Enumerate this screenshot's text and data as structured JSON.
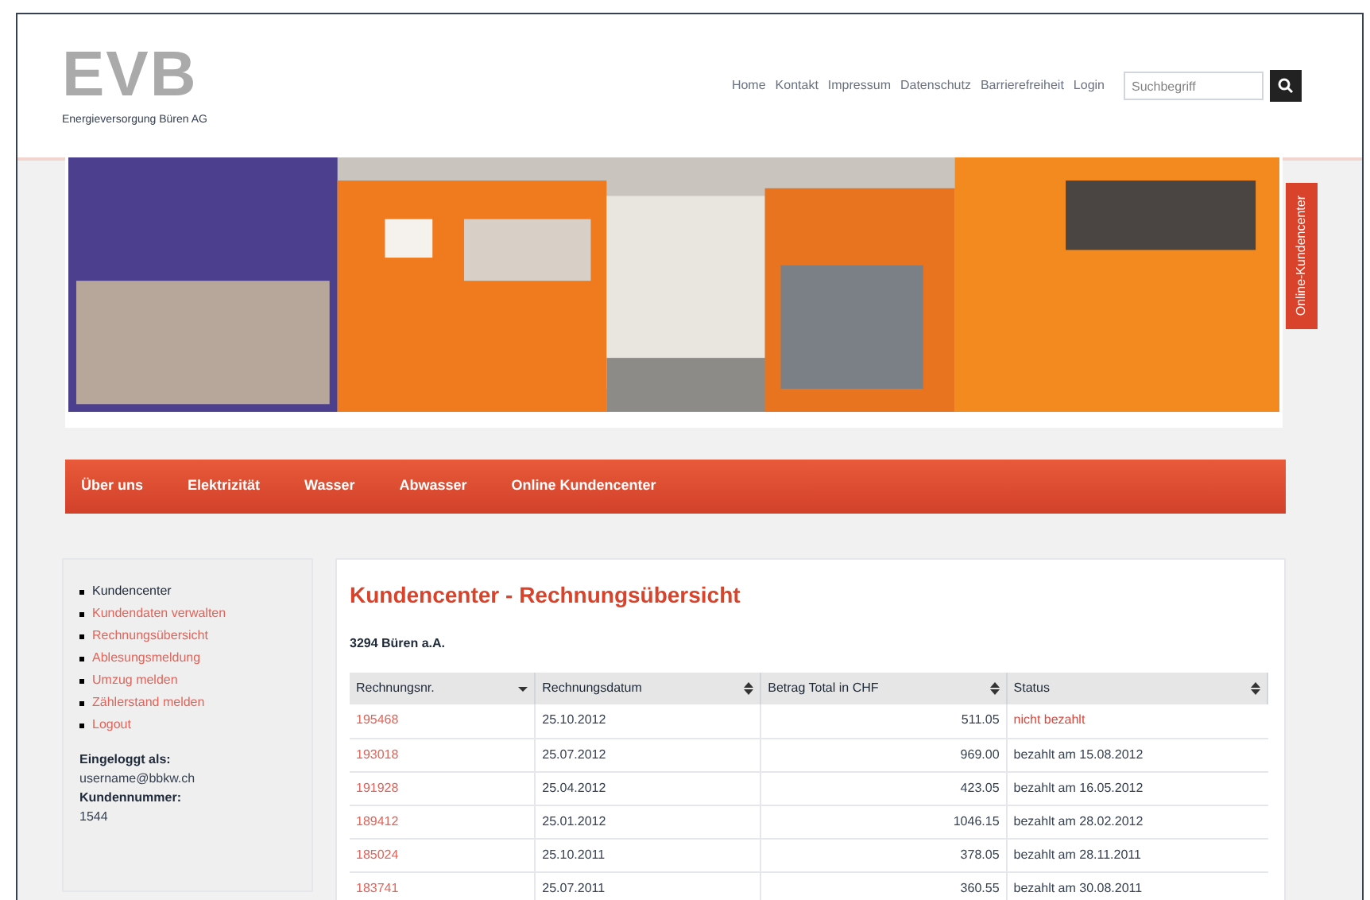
{
  "logo": {
    "letters": "EVB",
    "subtitle": "Energieversorgung Büren AG"
  },
  "top_nav": [
    "Home",
    "Kontakt",
    "Impressum",
    "Datenschutz",
    "Barrierefreiheit",
    "Login"
  ],
  "search": {
    "placeholder": "Suchbegriff"
  },
  "banner": {
    "kind": "picture"
  },
  "side_tab": "Online-Kundencenter",
  "menu": [
    "Über uns",
    "Elektrizität",
    "Wasser",
    "Abwasser",
    "Online Kundencenter"
  ],
  "sidebar": {
    "items": [
      {
        "label": "Kundencenter",
        "selected": true
      },
      {
        "label": "Kundendaten verwalten",
        "selected": false
      },
      {
        "label": "Rechnungsübersicht",
        "selected": false
      },
      {
        "label": "Ablesungsmeldung",
        "selected": false
      },
      {
        "label": "Umzug melden",
        "selected": false
      },
      {
        "label": "Zählerstand melden",
        "selected": false
      },
      {
        "label": "Logout",
        "selected": false
      }
    ],
    "login_label": "Eingeloggt als:",
    "login_value": "username@bbkw.ch",
    "customer_label": "Kundennummer:",
    "customer_value": "1544"
  },
  "main": {
    "title": "Kundencenter - Rechnungsübersicht",
    "location": "3294 Büren a.A.",
    "columns": [
      {
        "label": "Rechnungsnr.",
        "sorted": true
      },
      {
        "label": "Rechnungsdatum",
        "sorted": false
      },
      {
        "label": "Betrag Total in CHF",
        "sorted": false
      },
      {
        "label": "Status",
        "sorted": false
      }
    ],
    "rows": [
      {
        "number": "195468",
        "date": "25.10.2012",
        "amount": "511.05",
        "status": "nicht bezahlt",
        "paid": false
      },
      {
        "number": "193018",
        "date": "25.07.2012",
        "amount": "969.00",
        "status": "bezahlt am 15.08.2012",
        "paid": true
      },
      {
        "number": "191928",
        "date": "25.04.2012",
        "amount": "423.05",
        "status": "bezahlt am 16.05.2012",
        "paid": true
      },
      {
        "number": "189412",
        "date": "25.01.2012",
        "amount": "1046.15",
        "status": "bezahlt am 28.02.2012",
        "paid": true
      },
      {
        "number": "185024",
        "date": "25.10.2011",
        "amount": "378.05",
        "status": "bezahlt am 28.11.2011",
        "paid": true
      },
      {
        "number": "183741",
        "date": "25.07.2011",
        "amount": "360.55",
        "status": "bezahlt am 30.08.2011",
        "paid": true
      }
    ]
  }
}
